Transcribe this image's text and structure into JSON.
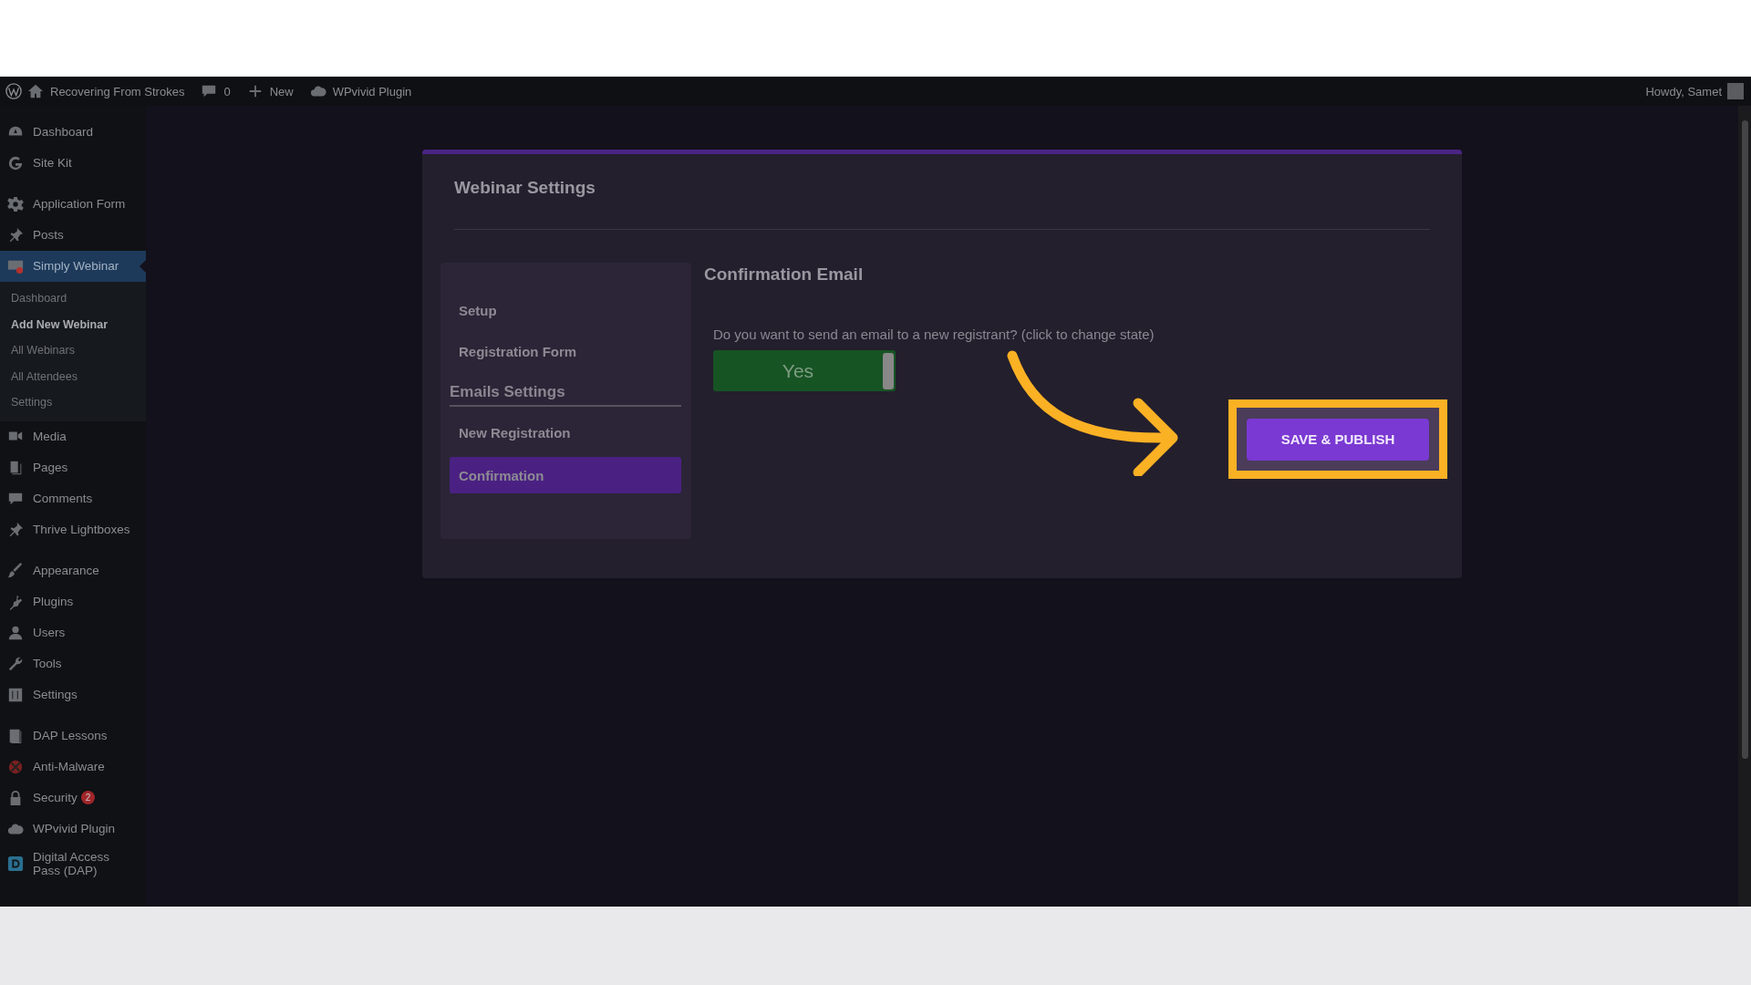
{
  "admin_bar": {
    "site_name": "Recovering From Strokes",
    "comments_count": "0",
    "new_label": "New",
    "plugin_label": "WPvivid Plugin",
    "greeting": "Howdy, Samet"
  },
  "sidebar": {
    "groups": [
      [
        {
          "label": "Dashboard",
          "selected": false
        },
        {
          "label": "Site Kit",
          "selected": false
        }
      ],
      [
        {
          "label": "Application Form",
          "selected": false
        },
        {
          "label": "Posts",
          "selected": false
        },
        {
          "label": "Simply Webinar",
          "selected": true,
          "submenu": [
            {
              "label": "Dashboard",
              "selected": false
            },
            {
              "label": "Add New Webinar",
              "selected": true
            },
            {
              "label": "All Webinars",
              "selected": false
            },
            {
              "label": "All Attendees",
              "selected": false
            },
            {
              "label": "Settings",
              "selected": false
            }
          ]
        },
        {
          "label": "Media",
          "selected": false
        },
        {
          "label": "Pages",
          "selected": false
        },
        {
          "label": "Comments",
          "selected": false
        },
        {
          "label": "Thrive Lightboxes",
          "selected": false
        }
      ],
      [
        {
          "label": "Appearance",
          "selected": false
        },
        {
          "label": "Plugins",
          "selected": false
        },
        {
          "label": "Users",
          "selected": false
        },
        {
          "label": "Tools",
          "selected": false
        },
        {
          "label": "Settings",
          "selected": false
        }
      ],
      [
        {
          "label": "DAP Lessons",
          "selected": false
        },
        {
          "label": "Anti-Malware",
          "selected": false
        },
        {
          "label": "Security",
          "selected": false,
          "badge": "2"
        },
        {
          "label": "WPvivid Plugin",
          "selected": false
        },
        {
          "label": "Digital Access Pass (DAP)",
          "selected": false
        }
      ]
    ]
  },
  "card": {
    "title": "Webinar Settings",
    "nav": [
      {
        "kind": "link",
        "label": "Setup",
        "selected": false
      },
      {
        "kind": "link",
        "label": "Registration Form",
        "selected": false
      },
      {
        "kind": "heading",
        "label": "Emails Settings"
      },
      {
        "kind": "link",
        "label": "New Registration",
        "selected": false
      },
      {
        "kind": "link",
        "label": "Confirmation",
        "selected": true
      }
    ],
    "section_title": "Confirmation Email",
    "question": "Do you want to send an email to a new registrant? (click to change state)",
    "toggle": {
      "label": "Yes",
      "on": true
    },
    "save_button": {
      "label": "SAVE & PUBLISH",
      "highlighted": true
    }
  }
}
